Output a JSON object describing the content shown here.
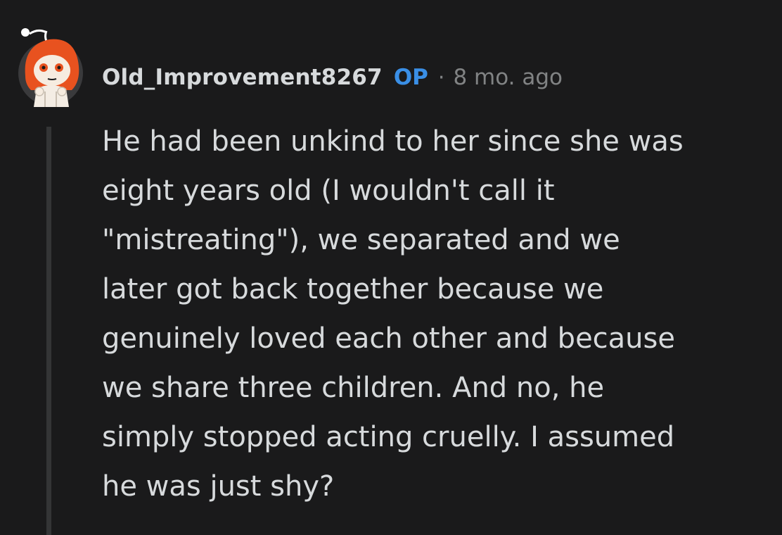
{
  "comment": {
    "username": "Old_Improvement8267",
    "badge": "OP",
    "separator": "·",
    "timestamp": "8 mo. ago",
    "avatar_icon": "snoo-avatar-icon",
    "body_lines": [
      "He had been unkind to her since she was",
      "eight years old (I wouldn't call it",
      "\"mistreating\"), we separated and we",
      "later got back together because we",
      "genuinely loved each other and because",
      "we share three children. And no, he",
      "simply stopped acting cruelly. I assumed",
      "he was just shy?"
    ]
  },
  "colors": {
    "background": "#1a1a1b",
    "text": "#d7dadc",
    "op_badge": "#3a8fe6",
    "meta": "#818384",
    "thread_line": "#343536"
  }
}
